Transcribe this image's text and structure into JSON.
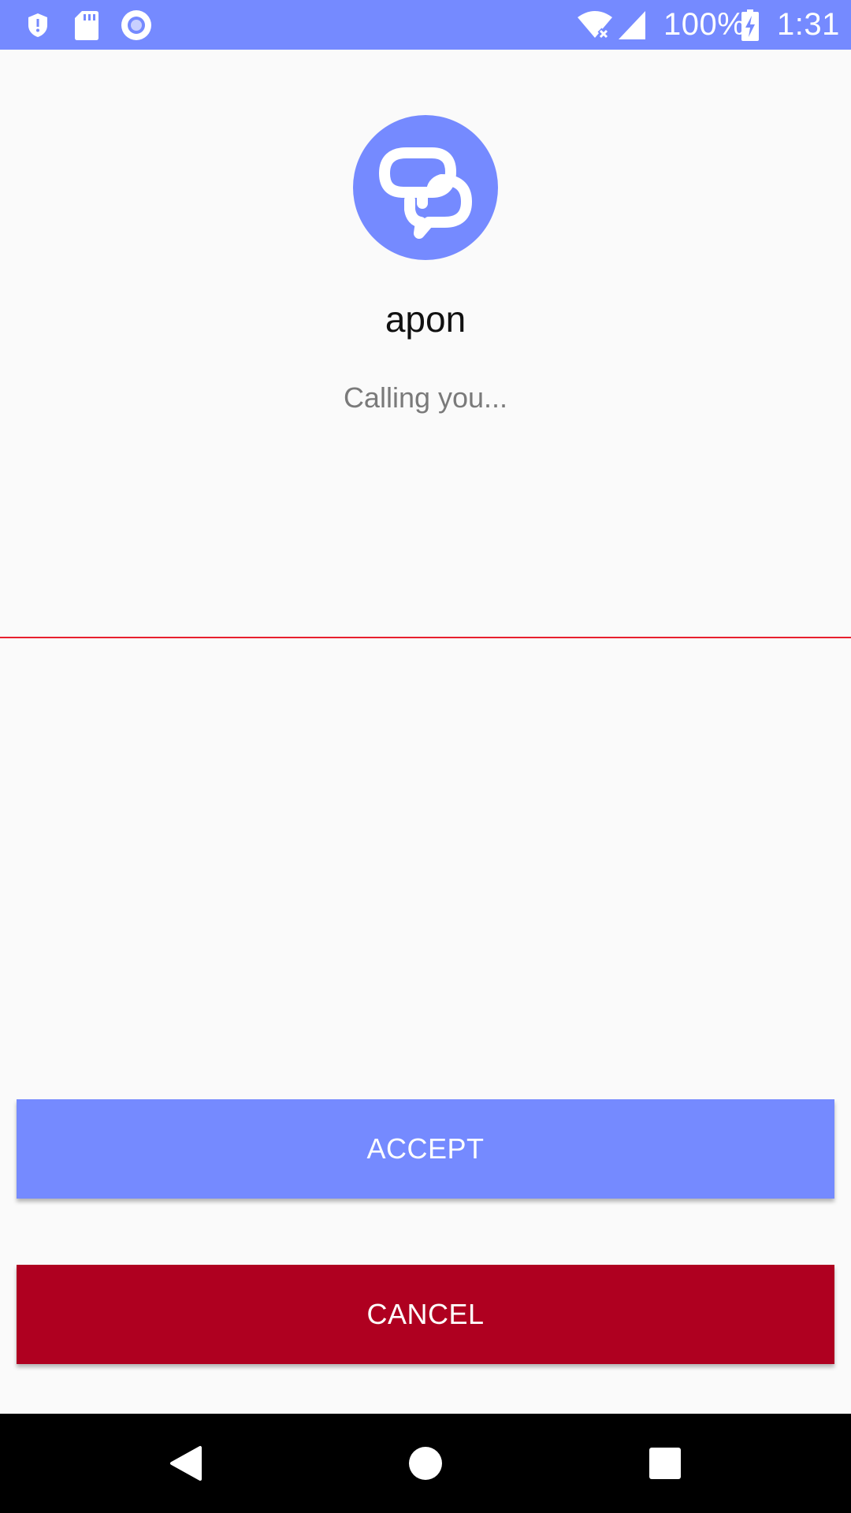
{
  "theme": {
    "primary": "#758AFF",
    "cancel": "#AF0020",
    "divider": "#E8202E",
    "background": "#FAFAFA"
  },
  "status_bar": {
    "left_icons": [
      "shield-icon",
      "sd-card-icon",
      "circle-record-icon"
    ],
    "right_icons": [
      "wifi-off-icon",
      "cell-signal-icon",
      "battery-charging-icon"
    ],
    "battery": "100%",
    "time": "1:31"
  },
  "caller": {
    "avatar_icon": "chat-bubbles-icon",
    "name": "apon",
    "status": "Calling you..."
  },
  "actions": {
    "accept_label": "ACCEPT",
    "cancel_label": "CANCEL"
  },
  "nav_bar": {
    "icons": [
      "back-icon",
      "home-icon",
      "recents-icon"
    ]
  }
}
